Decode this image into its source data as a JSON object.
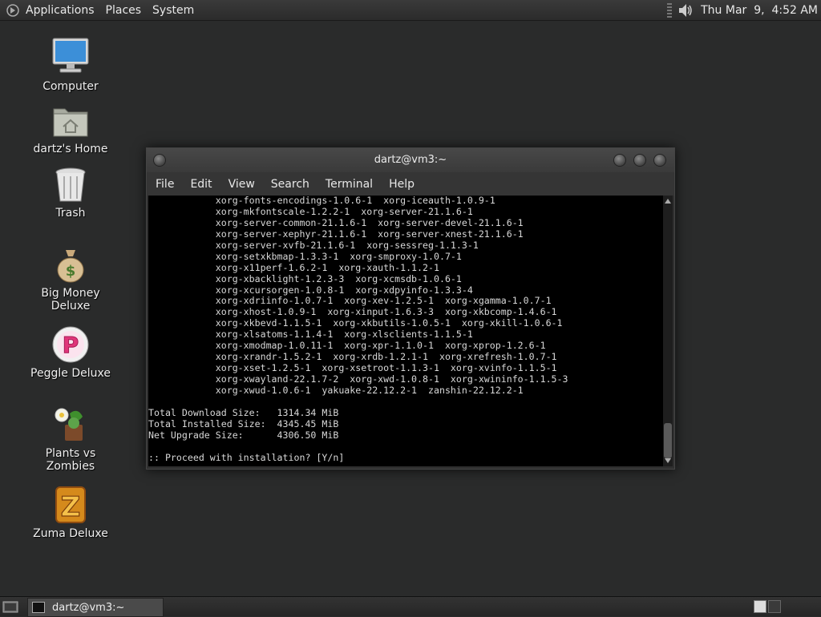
{
  "top_panel": {
    "menus": [
      "Applications",
      "Places",
      "System"
    ],
    "clock": "Thu Mar  9,  4:52 AM"
  },
  "desktop_icons": [
    {
      "label": "Computer",
      "icon": "computer-icon"
    },
    {
      "label": "dartz's Home",
      "icon": "home-folder-icon"
    },
    {
      "label": "Trash",
      "icon": "trash-icon"
    },
    {
      "label": "Big Money Deluxe",
      "icon": "money-bag-icon"
    },
    {
      "label": "Peggle Deluxe",
      "icon": "peggle-icon"
    },
    {
      "label": "Plants vs Zombies",
      "icon": "plants-vs-zombies-icon"
    },
    {
      "label": "Zuma Deluxe",
      "icon": "zuma-icon"
    }
  ],
  "window": {
    "title": "dartz@vm3:~",
    "menus": [
      "File",
      "Edit",
      "View",
      "Search",
      "Terminal",
      "Help"
    ],
    "terminal_lines": [
      "            xorg-fonts-encodings-1.0.6-1  xorg-iceauth-1.0.9-1",
      "            xorg-mkfontscale-1.2.2-1  xorg-server-21.1.6-1",
      "            xorg-server-common-21.1.6-1  xorg-server-devel-21.1.6-1",
      "            xorg-server-xephyr-21.1.6-1  xorg-server-xnest-21.1.6-1",
      "            xorg-server-xvfb-21.1.6-1  xorg-sessreg-1.1.3-1",
      "            xorg-setxkbmap-1.3.3-1  xorg-smproxy-1.0.7-1",
      "            xorg-x11perf-1.6.2-1  xorg-xauth-1.1.2-1",
      "            xorg-xbacklight-1.2.3-3  xorg-xcmsdb-1.0.6-1",
      "            xorg-xcursorgen-1.0.8-1  xorg-xdpyinfo-1.3.3-4",
      "            xorg-xdriinfo-1.0.7-1  xorg-xev-1.2.5-1  xorg-xgamma-1.0.7-1",
      "            xorg-xhost-1.0.9-1  xorg-xinput-1.6.3-3  xorg-xkbcomp-1.4.6-1",
      "            xorg-xkbevd-1.1.5-1  xorg-xkbutils-1.0.5-1  xorg-xkill-1.0.6-1",
      "            xorg-xlsatoms-1.1.4-1  xorg-xlsclients-1.1.5-1",
      "            xorg-xmodmap-1.0.11-1  xorg-xpr-1.1.0-1  xorg-xprop-1.2.6-1",
      "            xorg-xrandr-1.5.2-1  xorg-xrdb-1.2.1-1  xorg-xrefresh-1.0.7-1",
      "            xorg-xset-1.2.5-1  xorg-xsetroot-1.1.3-1  xorg-xvinfo-1.1.5-1",
      "            xorg-xwayland-22.1.7-2  xorg-xwd-1.0.8-1  xorg-xwininfo-1.1.5-3",
      "            xorg-xwud-1.0.6-1  yakuake-22.12.2-1  zanshin-22.12.2-1",
      "",
      "Total Download Size:   1314.34 MiB",
      "Total Installed Size:  4345.45 MiB",
      "Net Upgrade Size:      4306.50 MiB",
      "",
      ":: Proceed with installation? [Y/n]"
    ]
  },
  "taskbar": {
    "task_label": "dartz@vm3:~"
  }
}
